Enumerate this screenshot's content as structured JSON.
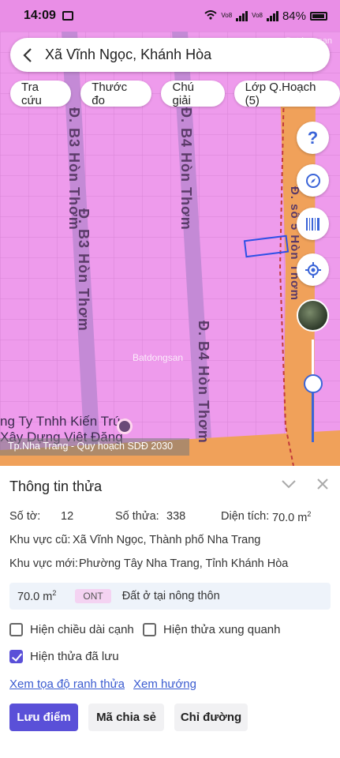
{
  "status_bar": {
    "time": "14:09",
    "battery": "84%",
    "net1": "Vo8",
    "net2": "Vo8"
  },
  "search": {
    "title": "Xã Vĩnh Ngọc, Khánh Hòa"
  },
  "chips": [
    "Tra cứu",
    "Thước đo",
    "Chú giải",
    "Lớp Q.Hoạch (5)"
  ],
  "map": {
    "road_labels": [
      "Đ. B3 Hòn Thơm",
      "Đ. B3 Hòn Thơm",
      "Đ. B4 Hòn Thơm",
      "Đ. B4 Hòn Thơm",
      "Đ. số 5 Hòn Thơm"
    ],
    "company_line1": "ng Ty Tnhh Kiến Trúc",
    "company_line2": "Xây Dựng Việt Đăng",
    "watermark": "Batdongsan",
    "footer": "Tp.Nha Trang - Quy hoạch SDĐ 2030",
    "colors": {
      "residential": "#ee9bec",
      "road": "#f0a15a",
      "street": "#c48ad6"
    }
  },
  "map_controls": {
    "help": "?",
    "icons": [
      "help-icon",
      "compass-icon",
      "barcode-icon",
      "locate-icon",
      "satellite-layer-icon"
    ]
  },
  "panel": {
    "title": "Thông tin thửa",
    "so_to_label": "Số tờ:",
    "so_to_value": "12",
    "so_thua_label": "Số thửa:",
    "so_thua_value": "338",
    "dien_tich_label": "Diện tích:",
    "dien_tich_value": "70.0 m",
    "dien_tich_sup": "2",
    "kv_cu_label": "Khu vực cũ:",
    "kv_cu_value": "Xã Vĩnh Ngọc, Thành phố Nha Trang",
    "kv_moi_label": "Khu vực mới:",
    "kv_moi_value": "Phường Tây Nha Trang, Tỉnh Khánh Hòa",
    "area_box_value": "70.0 m",
    "area_box_sup": "2",
    "land_code": "ONT",
    "land_desc": "Đất ở tại nông thôn",
    "check_edge": "Hiện chiều dài cạnh",
    "check_around": "Hiện thửa xung quanh",
    "check_saved": "Hiện thửa đã lưu",
    "check_saved_state": true,
    "link_coords": "Xem tọa độ ranh thửa",
    "link_direction": "Xem hướng",
    "btn_save": "Lưu điểm",
    "btn_share": "Mã chia sẻ",
    "btn_route": "Chỉ đường"
  }
}
